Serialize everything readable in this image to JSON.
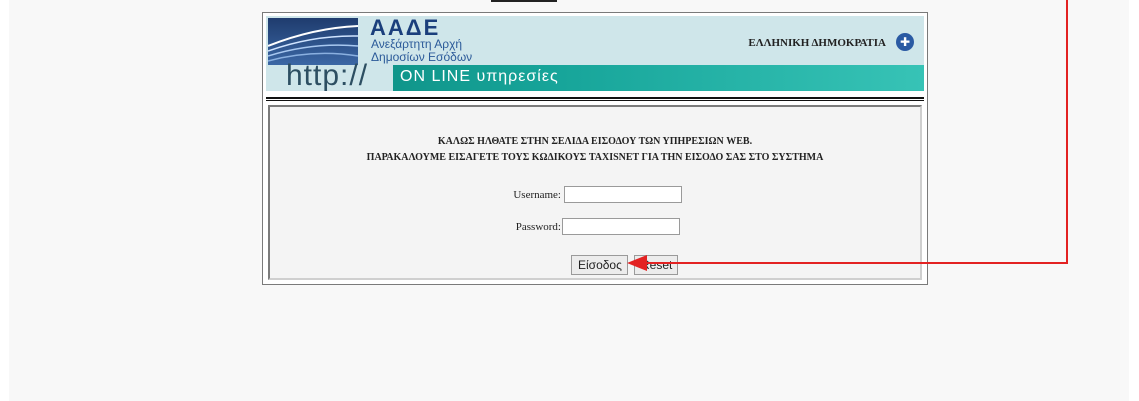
{
  "header": {
    "agency_acronym": "ΑΑΔΕ",
    "agency_name_line1": "Ανεξάρτητη Αρχή",
    "agency_name_line2": "Δημοσίων Εσόδων",
    "country": "ΕΛΛΗΝΙΚΗ ΔΗΜΟΚΡΑΤΙΑ",
    "http_text": "http://",
    "ribbon_text": "ON LINE υπηρεσίες"
  },
  "welcome": {
    "line1": "ΚΑΛΩΣ ΗΛΘΑΤΕ ΣΤΗΝ ΣΕΛΙΔΑ ΕΙΣΟΔΟΥ ΤΩΝ ΥΠΗΡΕΣΙΩΝ WEB.",
    "line2": "ΠΑΡΑΚΑΛΟΥΜΕ ΕΙΣΑΓΕΤΕ ΤΟΥΣ ΚΩΔΙΚΟΥΣ TAXISNET ΓΙΑ ΤΗΝ ΕΙΣΟΔΟ ΣΑΣ ΣΤΟ ΣΥΣΤΗΜΑ"
  },
  "form": {
    "username_label": "Username:",
    "username_value": "",
    "password_label": "Password:",
    "password_value": "",
    "login_button": "Είσοδος",
    "reset_button": "Reset"
  },
  "icons": {
    "emblem": "greek-emblem-icon",
    "annotation_arrow": "red-arrow-icon"
  },
  "colors": {
    "banner_bg": "#cfe6ea",
    "ribbon": "#17a59a",
    "annotation": "#e32222",
    "brand_blue": "#1b3f7c"
  }
}
